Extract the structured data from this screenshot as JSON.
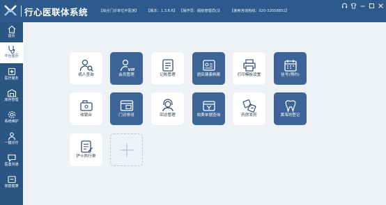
{
  "app": {
    "title": "行心医联体系统",
    "info": [
      "【综合门诊单位中医馆】",
      "【版本：1.3.8.6】",
      "【操作员：超级管理员()】",
      "【使用咨询热线：020-32058851】"
    ]
  },
  "window_buttons": [
    {
      "name": "headset-icon"
    },
    {
      "name": "skin-icon"
    },
    {
      "name": "minimize-icon"
    },
    {
      "name": "maximize-icon"
    },
    {
      "name": "close-icon"
    }
  ],
  "sidebar": {
    "items": [
      {
        "label": "首页",
        "icon": "home-icon",
        "active": false
      },
      {
        "label": "平台首页",
        "icon": "stethoscope-icon",
        "active": true
      },
      {
        "label": "医疗服务",
        "icon": "medical-icon",
        "active": false
      },
      {
        "label": "库存管理",
        "icon": "warehouse-icon",
        "active": false
      },
      {
        "label": "系统维护",
        "icon": "settings-icon",
        "active": false
      },
      {
        "label": "一键诊疗",
        "icon": "user-icon",
        "active": false
      },
      {
        "label": "医患沟通",
        "icon": "chat-icon",
        "active": false
      },
      {
        "label": "家庭健康",
        "icon": "family-icon",
        "active": false
      }
    ]
  },
  "tiles": [
    {
      "label": "病人查询",
      "icon": "patient-search-icon",
      "dark": false
    },
    {
      "label": "会员管理",
      "icon": "vip-member-icon",
      "dark": true
    },
    {
      "label": "记账管理",
      "icon": "ledger-icon",
      "dark": false
    },
    {
      "label": "居民健康档案",
      "icon": "health-record-icon",
      "dark": true
    },
    {
      "label": "打印模板设置",
      "icon": "printer-icon",
      "dark": false
    },
    {
      "label": "挂号(预约)",
      "icon": "calendar-icon",
      "dark": true
    },
    {
      "label": "收银台",
      "icon": "cash-register-icon",
      "dark": false
    },
    {
      "label": "门诊排班",
      "icon": "schedule-icon",
      "dark": true
    },
    {
      "label": "回访管理",
      "icon": "headset-callback-icon",
      "dark": false
    },
    {
      "label": "收费单据查询",
      "icon": "receipt-search-icon",
      "dark": true
    },
    {
      "label": "药房发药",
      "icon": "pharmacy-icon",
      "dark": false
    },
    {
      "label": "黄海坊登记",
      "icon": "tooth-icon",
      "dark": true
    },
    {
      "label": "护士执行单",
      "icon": "nurse-sheet-icon",
      "dark": false
    }
  ]
}
